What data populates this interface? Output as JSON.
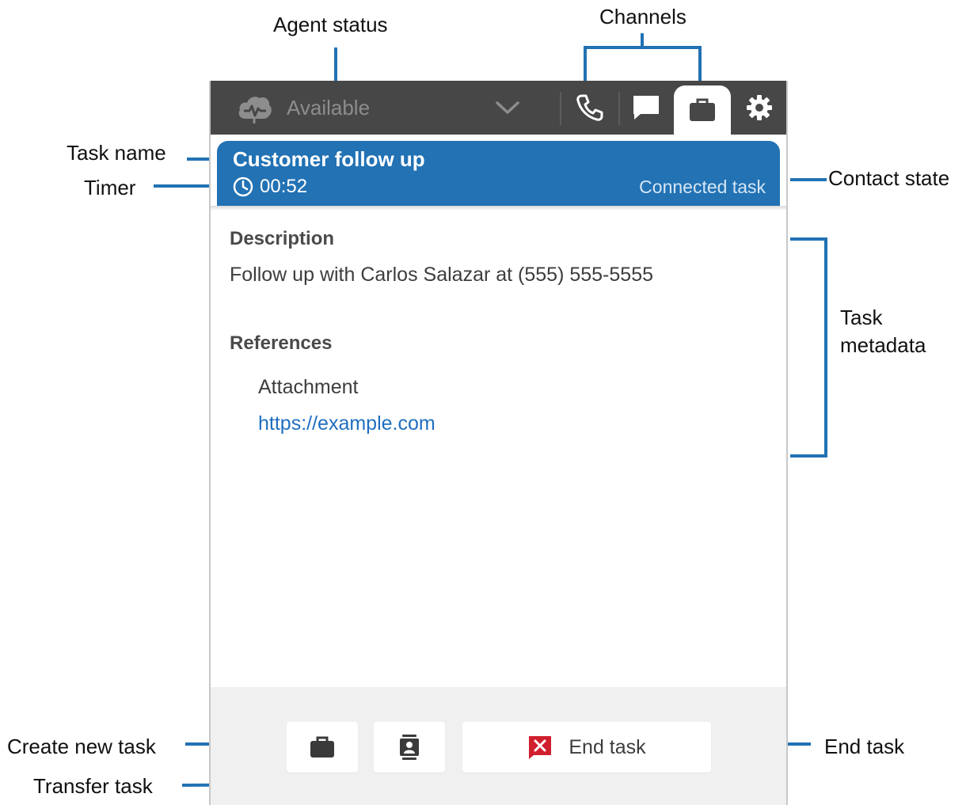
{
  "annotations": {
    "agent_status": "Agent status",
    "channels": "Channels",
    "task_name": "Task name",
    "timer": "Timer",
    "contact_state": "Contact state",
    "task_metadata_line1": "Task",
    "task_metadata_line2": "metadata",
    "create_new_task": "Create new task",
    "transfer_task": "Transfer task",
    "end_task": "End task"
  },
  "topbar": {
    "status_label": "Available",
    "status_icon": "cloud-status-icon",
    "channel_icons": [
      "phone-icon",
      "chat-icon",
      "briefcase-icon",
      "gear-icon"
    ],
    "active_channel": "briefcase-icon"
  },
  "contact": {
    "name": "Customer follow up",
    "timer": "00:52",
    "state": "Connected task"
  },
  "details": {
    "description_title": "Description",
    "description_text": "Follow up with Carlos Salazar at (555) 555-5555",
    "references_title": "References",
    "reference_name": "Attachment",
    "reference_link": "https://example.com"
  },
  "footer": {
    "end_task_label": "End task"
  },
  "colors": {
    "topbar": "#474747",
    "contact_bar": "#2272b4",
    "annotation_line": "#2272b4",
    "link": "#1f6fc0",
    "end_icon": "#d0202e"
  }
}
